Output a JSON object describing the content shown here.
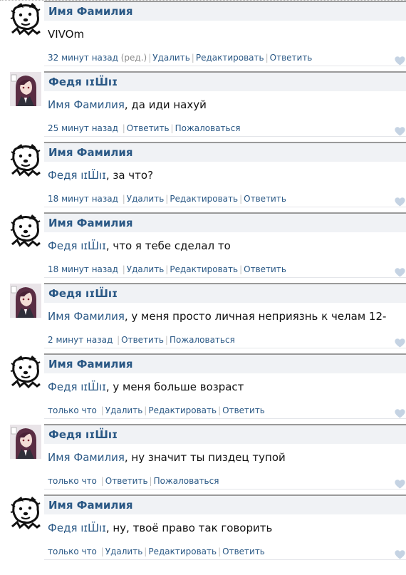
{
  "comments": [
    {
      "author": "Имя Фамилия",
      "mention": "",
      "text": "VIVOm",
      "avatar": "dog-avatar",
      "time": "32 минут назад",
      "edited": "(ред.)",
      "actions": [
        "Удалить",
        "Редактировать",
        "Ответить"
      ]
    },
    {
      "author": "Федя ıɪШ̈ıɪ",
      "mention": "Имя Фамилия",
      "text": ", да иди нахуй",
      "avatar": "anime-avatar",
      "time": "25 минут назад",
      "edited": "",
      "actions": [
        "Ответить",
        "Пожаловаться"
      ]
    },
    {
      "author": "Имя Фамилия",
      "mention": "Федя ıɪШ̈ıɪ",
      "text": ", за что?",
      "avatar": "dog-avatar",
      "time": "18 минут назад",
      "edited": "",
      "actions": [
        "Удалить",
        "Редактировать",
        "Ответить"
      ]
    },
    {
      "author": "Имя Фамилия",
      "mention": "Федя ıɪШ̈ıɪ",
      "text": ", что я тебе сделал то",
      "avatar": "dog-avatar",
      "time": "18 минут назад",
      "edited": "",
      "actions": [
        "Удалить",
        "Редактировать",
        "Ответить"
      ]
    },
    {
      "author": "Федя ıɪШ̈ıɪ",
      "mention": "Имя Фамилия",
      "text": ", у меня просто личная неприязнь к челам 12-",
      "avatar": "anime-avatar",
      "time": "2 минут назад",
      "edited": "",
      "actions": [
        "Ответить",
        "Пожаловаться"
      ]
    },
    {
      "author": "Имя Фамилия",
      "mention": "Федя ıɪШ̈ıɪ",
      "text": ", у меня больше возраст",
      "avatar": "dog-avatar",
      "time": "только что",
      "edited": "",
      "actions": [
        "Удалить",
        "Редактировать",
        "Ответить"
      ]
    },
    {
      "author": "Федя ıɪШ̈ıɪ",
      "mention": "Имя Фамилия",
      "text": ", ну значит ты пиздец тупой",
      "avatar": "anime-avatar",
      "time": "только что",
      "edited": "",
      "actions": [
        "Ответить",
        "Пожаловаться"
      ]
    },
    {
      "author": "Имя Фамилия",
      "mention": "Федя ıɪШ̈ıɪ",
      "text": ", ну, твоё право так говорить",
      "avatar": "dog-avatar",
      "time": "только что",
      "edited": "",
      "actions": [
        "Удалить",
        "Редактировать",
        "Ответить"
      ]
    }
  ],
  "like_icon": "heart-icon",
  "colors": {
    "link": "#2a5885",
    "header_bg": "#f0f2f5",
    "like": "#c5d3e3"
  }
}
